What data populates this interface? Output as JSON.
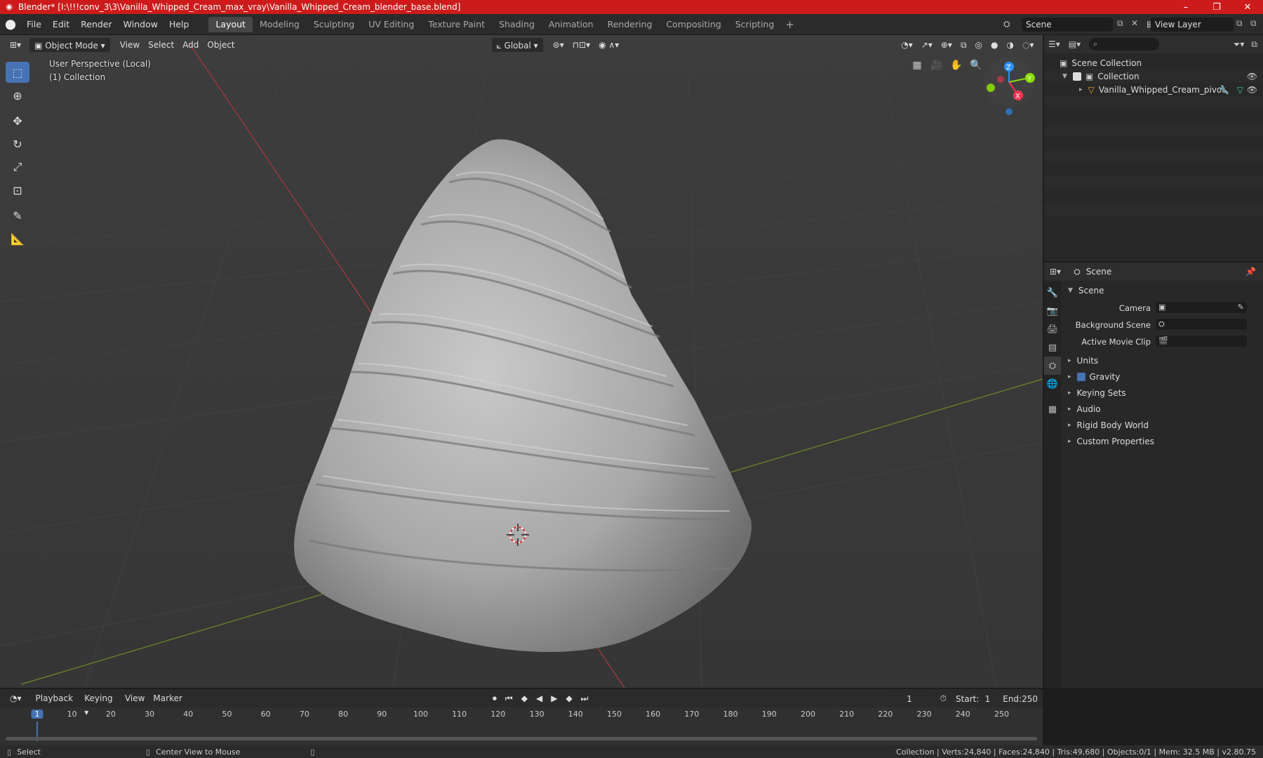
{
  "window": {
    "title": "Blender* [I:\\!!!conv_3\\3\\Vanilla_Whipped_Cream_max_vray\\Vanilla_Whipped_Cream_blender_base.blend]",
    "minimize": "–",
    "maximize": "❐",
    "close": "✕"
  },
  "menu": [
    "File",
    "Edit",
    "Render",
    "Window",
    "Help"
  ],
  "workspaces": [
    "Layout",
    "Modeling",
    "Sculpting",
    "UV Editing",
    "Texture Paint",
    "Shading",
    "Animation",
    "Rendering",
    "Compositing",
    "Scripting"
  ],
  "active_workspace": "Layout",
  "add_workspace": "+",
  "scene_selector": {
    "value": "Scene"
  },
  "view_layer_selector": {
    "value": "View Layer"
  },
  "viewport": {
    "mode": "Object Mode",
    "menus": [
      "View",
      "Select",
      "Add",
      "Object"
    ],
    "transform_orientation": "Global",
    "overlay_title": "User Perspective (Local)",
    "overlay_collection": "(1) Collection",
    "gizmo_axes": {
      "x": "X",
      "y": "Y",
      "z": "Z"
    },
    "axis_colors": {
      "x": "#ff3352",
      "y": "#8bdc00",
      "z": "#2890ff"
    }
  },
  "outliner": {
    "search_placeholder": "",
    "root": "Scene Collection",
    "collection": "Collection",
    "object": "Vanilla_Whipped_Cream_pivot"
  },
  "properties": {
    "context": "Scene",
    "panel_scene": "Scene",
    "labels": {
      "camera": "Camera",
      "background_scene": "Background Scene",
      "active_movie_clip": "Active Movie Clip"
    },
    "panels": [
      "Units",
      "Gravity",
      "Keying Sets",
      "Audio",
      "Rigid Body World",
      "Custom Properties"
    ],
    "gravity_enabled": true
  },
  "timeline": {
    "menus": [
      "Playback",
      "Keying",
      "View",
      "Marker"
    ],
    "current_frame": "1",
    "start_label": "Start:",
    "start": "1",
    "end_label": "End:",
    "end": "250",
    "ruler": [
      "1",
      "10",
      "20",
      "30",
      "40",
      "50",
      "60",
      "70",
      "80",
      "90",
      "100",
      "110",
      "120",
      "130",
      "140",
      "150",
      "160",
      "170",
      "180",
      "190",
      "200",
      "210",
      "220",
      "230",
      "240",
      "250"
    ]
  },
  "statusbar": {
    "select": "Select",
    "center_view": "Center View to Mouse",
    "stats": "Collection | Verts:24,840 | Faces:24,840 | Tris:49,680 | Objects:0/1 | Mem: 32.5 MB | v2.80.75"
  },
  "colors": {
    "accent": "#4772b3",
    "titlebar": "#cd1b1b"
  }
}
